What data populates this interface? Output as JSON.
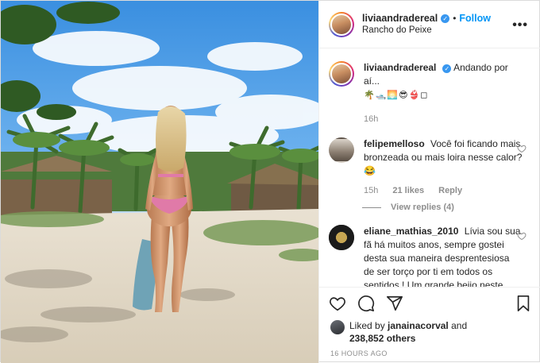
{
  "post": {
    "author": {
      "username": "livia.andradereal",
      "username_display": "liviaandradereal",
      "follow_label": "Follow",
      "separator": "•",
      "location": "Rancho do Peixe",
      "more_label": "•••"
    },
    "caption": {
      "username": "liviaandradereal",
      "text": "Andando por aí...",
      "emoji_line": "🌴🛥️🌅😎👙◻",
      "age": "16h"
    },
    "comments": [
      {
        "username": "felipemelloso",
        "text": "Você foi ficando mais bronzeada ou mais loira nesse calor?😂",
        "age": "15h",
        "likes": "21 likes",
        "reply_label": "Reply",
        "view_replies": "View replies (4)"
      },
      {
        "username": "eliane_mathias_2010",
        "text": "Lívia sou sua fã há muitos anos, sempre gostei desta sua maneira desprentesiosa de ser torço por ti em todos os sentidos ! Um grande beijo neste coração! Eliane."
      }
    ],
    "likes": {
      "prefix": "Liked by",
      "liker": "janainacorval",
      "conjunction": "and",
      "others": "238,852 others"
    },
    "timestamp": "16 HOURS AGO"
  },
  "icons": {
    "verified": "verified-badge-icon",
    "heart": "heart-icon",
    "comment": "comment-icon",
    "share": "share-icon",
    "save": "bookmark-icon",
    "more": "more-options-icon"
  },
  "colors": {
    "link_blue": "#0095f6",
    "verified_blue": "#3897f0",
    "muted_text": "#8e8e8e",
    "border": "#efefef"
  }
}
